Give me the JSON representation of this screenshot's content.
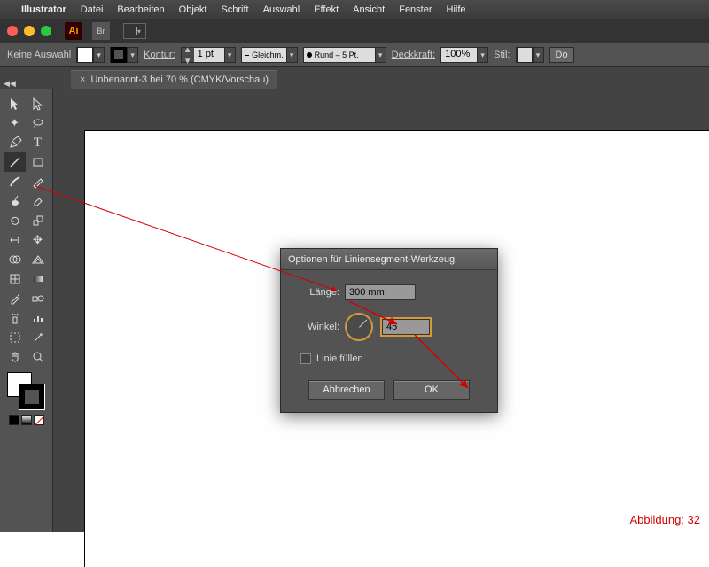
{
  "menubar": {
    "appname": "Illustrator",
    "items": [
      "Datei",
      "Bearbeiten",
      "Objekt",
      "Schrift",
      "Auswahl",
      "Effekt",
      "Ansicht",
      "Fenster",
      "Hilfe"
    ]
  },
  "ctrl": {
    "selection": "Keine Auswahl",
    "konturLabel": "Kontur:",
    "strokeWeight": "1 pt",
    "dashLabel": "Gleichm.",
    "brushLabel": "Rund – 5 Pt.",
    "opacityLabel": "Deckkraft:",
    "opacity": "100%",
    "styleLabel": "Stil:",
    "docBtn": "Do"
  },
  "tab": {
    "title": "Unbenannt-3 bei 70 % (CMYK/Vorschau)"
  },
  "dialog": {
    "title": "Optionen für Liniensegment-Werkzeug",
    "lengthLabel": "Länge:",
    "lengthValue": "300 mm",
    "angleLabel": "Winkel:",
    "angleValue": "45",
    "fillLine": "Linie füllen",
    "cancel": "Abbrechen",
    "ok": "OK"
  },
  "caption": "Abbildung: 32"
}
